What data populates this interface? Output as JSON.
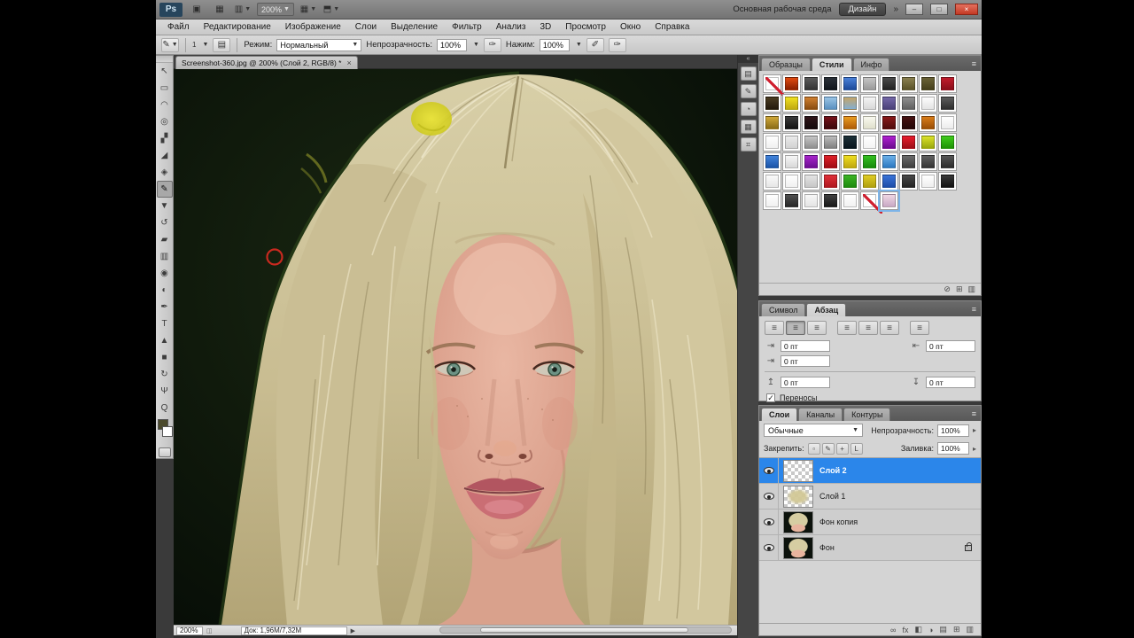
{
  "app_bar": {
    "logo": "Ps",
    "zoom_level": "200%",
    "workspace_label": "Основная рабочая среда",
    "design_button": "Дизайн",
    "overflow": "»",
    "minimize": "–",
    "maximize": "□",
    "close": "×"
  },
  "menu": {
    "items": [
      "Файл",
      "Редактирование",
      "Изображение",
      "Слои",
      "Выделение",
      "Фильтр",
      "Анализ",
      "3D",
      "Просмотр",
      "Окно",
      "Справка"
    ]
  },
  "options_bar": {
    "brush_size": "1",
    "mode_label": "Режим:",
    "mode_value": "Нормальный",
    "opacity_label": "Непрозрачность:",
    "opacity_value": "100%",
    "flow_label": "Нажим:",
    "flow_value": "100%"
  },
  "toolbar": {
    "foreground_color": "#4b4a2c",
    "background_color": "#ffffff",
    "tools": [
      {
        "name": "move-tool",
        "glyph": "↖"
      },
      {
        "name": "marquee-tool",
        "glyph": "▭"
      },
      {
        "name": "lasso-tool",
        "glyph": "◠"
      },
      {
        "name": "quick-selection-tool",
        "glyph": "◎"
      },
      {
        "name": "crop-tool",
        "glyph": "▞"
      },
      {
        "name": "eyedropper-tool",
        "glyph": "◢"
      },
      {
        "name": "healing-brush-tool",
        "glyph": "◈"
      },
      {
        "name": "brush-tool",
        "glyph": "✎",
        "selected": true
      },
      {
        "name": "clone-stamp-tool",
        "glyph": "▼"
      },
      {
        "name": "history-brush-tool",
        "glyph": "↺"
      },
      {
        "name": "eraser-tool",
        "glyph": "▰"
      },
      {
        "name": "gradient-tool",
        "glyph": "▥"
      },
      {
        "name": "blur-tool",
        "glyph": "◉"
      },
      {
        "name": "dodge-tool",
        "glyph": "◐"
      },
      {
        "name": "pen-tool",
        "glyph": "✒"
      },
      {
        "name": "type-tool",
        "glyph": "T"
      },
      {
        "name": "path-selection-tool",
        "glyph": "▲"
      },
      {
        "name": "shape-tool",
        "glyph": "■"
      },
      {
        "name": "rotate-view-tool",
        "glyph": "↻"
      },
      {
        "name": "hand-tool",
        "glyph": "Ψ"
      },
      {
        "name": "zoom-tool",
        "glyph": "Q"
      }
    ]
  },
  "dock": {
    "collapse": "«",
    "buttons": [
      "▤",
      "✎",
      "◔",
      "▦",
      "⌗"
    ]
  },
  "document": {
    "tab_title": "Screenshot-360.jpg @ 200% (Слой 2, RGB/8) *",
    "tab_close": "×",
    "status_zoom": "200%",
    "status_doc": "Док: 1,96М/7,32М",
    "status_arrow": "▶"
  },
  "canvas_art": {
    "background": "#0c130b",
    "rim_green": "#2f4a1b",
    "hair_base": "#cdc39c",
    "hair_front": "#cabe94",
    "skin": "#dba08c",
    "skin_light": "#ecc1ad",
    "neck": "#d9a18c",
    "lips_upper": "#b25560",
    "lips_lower": "#ca6e74",
    "iris": "#6d9284",
    "highlight_blob": "#e2de2e",
    "brush_cursor": "#c9291f"
  },
  "panels": {
    "styles": {
      "tabs": [
        "Образцы",
        "Стили",
        "Инфо"
      ],
      "active_tab": "Стили",
      "footer_icons": [
        {
          "name": "clear-style-button",
          "glyph": "⊘"
        },
        {
          "name": "new-style-button",
          "glyph": "⊞"
        },
        {
          "name": "delete-style-button",
          "glyph": "▥"
        }
      ],
      "swatches": [
        {
          "t": "none"
        },
        {
          "t": "g",
          "c": [
            "#e04a10",
            "#8a2000"
          ]
        },
        {
          "t": "g",
          "c": [
            "#5a5a5a",
            "#333333"
          ]
        },
        {
          "t": "g",
          "c": [
            "#2a3038",
            "#11161c"
          ]
        },
        {
          "t": "g",
          "c": [
            "#4a80d8",
            "#1c4a9a"
          ]
        },
        {
          "t": "g",
          "c": [
            "#c4c4c4",
            "#9a9a9a"
          ]
        },
        {
          "t": "g",
          "c": [
            "#4a4a4a",
            "#222222"
          ]
        },
        {
          "t": "g",
          "c": [
            "#8a8050",
            "#5a5228"
          ]
        },
        {
          "t": "g",
          "c": [
            "#6a6236",
            "#46401c"
          ]
        },
        {
          "t": "g",
          "c": [
            "#c01c2c",
            "#8a0e1a"
          ]
        },
        {
          "t": "g",
          "c": [
            "#4a3c22",
            "#241a0c"
          ]
        },
        {
          "t": "g",
          "c": [
            "#f0e020",
            "#c0aa10"
          ]
        },
        {
          "t": "g",
          "c": [
            "#d08030",
            "#8a4c10"
          ]
        },
        {
          "t": "g",
          "c": [
            "#9ac4e4",
            "#5a90c0"
          ]
        },
        {
          "t": "g",
          "c": [
            "#c4a468",
            "#84aed0"
          ]
        },
        {
          "t": "g",
          "c": [
            "#f4f4f4",
            "#d8d8d8"
          ]
        },
        {
          "t": "g",
          "c": [
            "#7468a8",
            "#4a4078"
          ]
        },
        {
          "t": "g",
          "c": [
            "#909090",
            "#606060"
          ]
        },
        {
          "t": "g",
          "c": [
            "#fcfcfc",
            "#e4e4e4"
          ]
        },
        {
          "t": "g",
          "c": [
            "#5c5c5c",
            "#2e2e2e"
          ]
        },
        {
          "t": "g",
          "c": [
            "#d0a838",
            "#8a6c18"
          ]
        },
        {
          "t": "g",
          "c": [
            "#3a3a3a",
            "#141414"
          ]
        },
        {
          "t": "g",
          "c": [
            "#301418",
            "#140a0c"
          ]
        },
        {
          "t": "g",
          "c": [
            "#781018",
            "#3c080c"
          ]
        },
        {
          "t": "g",
          "c": [
            "#e89c20",
            "#b05c08"
          ]
        },
        {
          "t": "g",
          "c": [
            "#f8f8ee",
            "#e0e0cc"
          ]
        },
        {
          "t": "g",
          "c": [
            "#8a1818",
            "#500c0c"
          ]
        },
        {
          "t": "g",
          "c": [
            "#461010",
            "#240808"
          ]
        },
        {
          "t": "g",
          "c": [
            "#d87c18",
            "#9a4e06"
          ]
        },
        {
          "t": "g",
          "c": [
            "#ffffff",
            "#ececec"
          ]
        },
        {
          "t": "g",
          "c": [
            "#ffffff",
            "#f0f0f0"
          ]
        },
        {
          "t": "g",
          "c": [
            "#ebebeb",
            "#d2d2d2"
          ]
        },
        {
          "t": "g",
          "c": [
            "#c6c6c6",
            "#8e8e8e"
          ]
        },
        {
          "t": "g",
          "c": [
            "#bcbcbc",
            "#808080"
          ]
        },
        {
          "t": "g",
          "c": [
            "#1c3038",
            "#0a161e"
          ]
        },
        {
          "t": "g",
          "c": [
            "#ffffff",
            "#f4f4f4"
          ]
        },
        {
          "t": "g",
          "c": [
            "#b020d0",
            "#6c0c90"
          ]
        },
        {
          "t": "g",
          "c": [
            "#e81c2c",
            "#9c0e18"
          ]
        },
        {
          "t": "g",
          "c": [
            "#dce22a",
            "#9aa80e"
          ]
        },
        {
          "t": "g",
          "c": [
            "#40cc1c",
            "#1e9406"
          ]
        },
        {
          "t": "g",
          "c": [
            "#4284dc",
            "#1a54a8"
          ]
        },
        {
          "t": "g",
          "c": [
            "#f6f6f6",
            "#d8d8d8"
          ]
        },
        {
          "t": "g",
          "c": [
            "#a824cc",
            "#6c0e92"
          ]
        },
        {
          "t": "g",
          "c": [
            "#e02028",
            "#a00c14"
          ]
        },
        {
          "t": "g",
          "c": [
            "#eede20",
            "#c0a810"
          ]
        },
        {
          "t": "g",
          "c": [
            "#34c020",
            "#188c0c"
          ]
        },
        {
          "t": "g",
          "c": [
            "#6cb0e8",
            "#2c78c0"
          ]
        },
        {
          "t": "g",
          "c": [
            "#6a6a6a",
            "#3e3e3e"
          ]
        },
        {
          "t": "g",
          "c": [
            "#606060",
            "#343434"
          ]
        },
        {
          "t": "g",
          "c": [
            "#565656",
            "#2c2c2c"
          ]
        },
        {
          "t": "g",
          "c": [
            "#fafafa",
            "#e6e6e6"
          ]
        },
        {
          "t": "g",
          "c": [
            "#ffffff",
            "#f0f0f0"
          ]
        },
        {
          "t": "g",
          "c": [
            "#e4e4e4",
            "#c6c6c6"
          ]
        },
        {
          "t": "g",
          "c": [
            "#e03038",
            "#b01820"
          ]
        },
        {
          "t": "g",
          "c": [
            "#3cb424",
            "#1e8c10"
          ]
        },
        {
          "t": "g",
          "c": [
            "#e0cc24",
            "#b0a010"
          ]
        },
        {
          "t": "g",
          "c": [
            "#3a74d8",
            "#1c4ca8"
          ]
        },
        {
          "t": "g",
          "c": [
            "#484848",
            "#242424"
          ]
        },
        {
          "t": "g",
          "c": [
            "#ffffff",
            "#eeeeee"
          ]
        },
        {
          "t": "g",
          "c": [
            "#383838",
            "#101010"
          ]
        },
        {
          "t": "g",
          "c": [
            "#ffffff",
            "#f0f0f0"
          ]
        },
        {
          "t": "g",
          "c": [
            "#505050",
            "#282828"
          ]
        },
        {
          "t": "g",
          "c": [
            "#f8f8f8",
            "#e4e4e4"
          ]
        },
        {
          "t": "g",
          "c": [
            "#404040",
            "#1a1a1a"
          ]
        },
        {
          "t": "g",
          "c": [
            "#ffffff",
            "#f2f2f2"
          ]
        },
        {
          "t": "none"
        },
        {
          "t": "g",
          "c": [
            "#f0d8e4",
            "#c8a8c4"
          ],
          "sel": true
        }
      ]
    },
    "paragraph": {
      "tabs": [
        "Символ",
        "Абзац"
      ],
      "active_tab": "Абзац",
      "align_buttons": [
        "align-left",
        "align-center",
        "align-right",
        "justify-last-left",
        "justify-last-center",
        "justify-last-right",
        "justify-all"
      ],
      "selected_align": 1,
      "fields": [
        {
          "name": "indent-left",
          "icon": "⇥",
          "value": "0 пт"
        },
        {
          "name": "indent-right",
          "icon": "⇤",
          "value": "0 пт"
        },
        {
          "name": "indent-first-line",
          "icon": "⇥",
          "value": "0 пт"
        },
        {
          "name": "space-before",
          "icon": "↥",
          "value": "0 пт"
        },
        {
          "name": "space-after",
          "icon": "↧",
          "value": "0 пт"
        }
      ],
      "hyphenate_label": "Переносы",
      "hyphenate_checked": "✓"
    },
    "layers": {
      "tabs": [
        "Слои",
        "Каналы",
        "Контуры"
      ],
      "active_tab": "Слои",
      "blend_mode": "Обычные",
      "opacity_label": "Непрозрачность:",
      "opacity_value": "100%",
      "lock_label": "Закрепить:",
      "lock_buttons": [
        "▫",
        "✎",
        "+",
        "L"
      ],
      "fill_label": "Заливка:",
      "fill_value": "100%",
      "layers": [
        {
          "name": "Слой 2",
          "thumb": "checker",
          "selected": true,
          "visible": true
        },
        {
          "name": "Слой 1",
          "thumb": "checker-paint",
          "visible": true
        },
        {
          "name": "Фон копия",
          "thumb": "portrait",
          "visible": true
        },
        {
          "name": "Фон",
          "thumb": "portrait",
          "visible": true,
          "locked": true
        }
      ],
      "footer_icons": [
        {
          "name": "link-layers-button",
          "glyph": "∞"
        },
        {
          "name": "layer-style-button",
          "glyph": "fx"
        },
        {
          "name": "add-mask-button",
          "glyph": "◧"
        },
        {
          "name": "adjustment-layer-button",
          "glyph": "◑"
        },
        {
          "name": "new-group-button",
          "glyph": "▤"
        },
        {
          "name": "new-layer-button",
          "glyph": "⊞"
        },
        {
          "name": "delete-layer-button",
          "glyph": "▥"
        }
      ]
    }
  },
  "colors": {
    "selection_blue": "#2b86ea",
    "close_red": "#c33a24"
  }
}
